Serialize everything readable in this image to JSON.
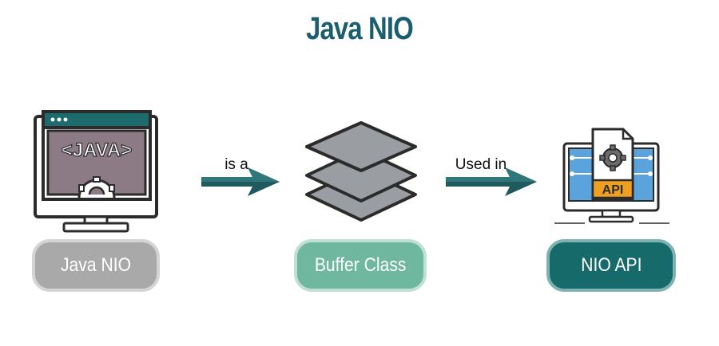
{
  "title": "Java NIO",
  "colors": {
    "title": "#1b5e6e",
    "arrow": "#1e5a5e",
    "outline": "#2b2b2b",
    "java_screen": "#8c7b85",
    "stack_layer": "#9a9da2",
    "api_screen": "#5aa3dc",
    "api_label": "#f0a020"
  },
  "nodes": [
    {
      "label": "Java NIO",
      "icon": "java-monitor-icon",
      "icon_text": "<JAVA>",
      "fill": "#a9a9a9",
      "border": "#d4d4d4"
    },
    {
      "label": "Buffer Class",
      "icon": "stacked-layers-icon",
      "fill": "#6fb79e",
      "border": "#bfe0d3"
    },
    {
      "label": "NIO API",
      "icon": "api-monitor-icon",
      "icon_text": "API",
      "fill": "#176a6a",
      "border": "#7fb3b3"
    }
  ],
  "edges": [
    {
      "label": "is a"
    },
    {
      "label": "Used in"
    }
  ]
}
